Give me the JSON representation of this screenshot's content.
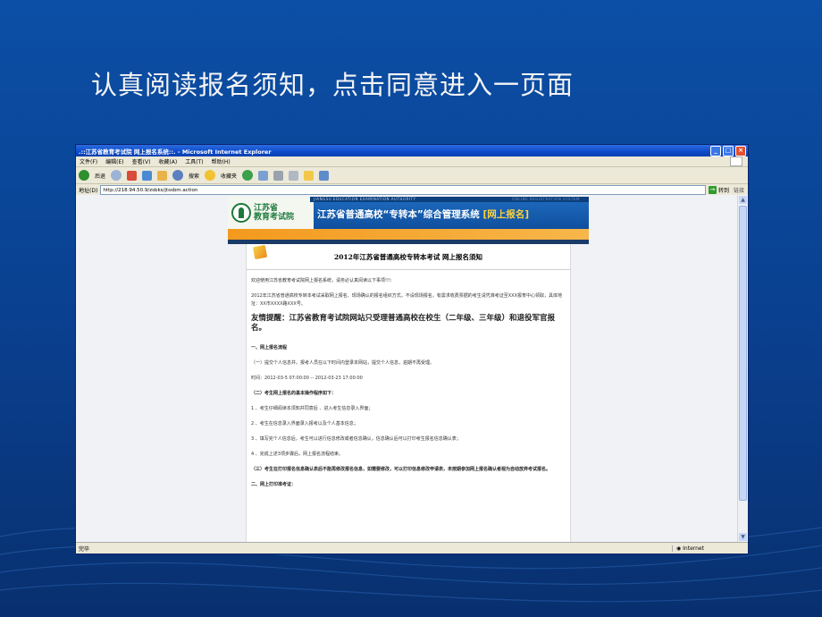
{
  "slide": {
    "title": "认真阅读报名须知，点击同意进入一页面"
  },
  "browser": {
    "window_title": ".::江苏省教育考试院 网上报名系统::. - Microsoft Internet Explorer",
    "menu": [
      "文件(F)",
      "编辑(E)",
      "查看(V)",
      "收藏(A)",
      "工具(T)",
      "帮助(H)"
    ],
    "toolbar": {
      "back": "后退",
      "search": "搜索",
      "favorites": "收藏夹"
    },
    "address_label": "地址(D)",
    "address": "http://218.94.50.9/zsbks/jtssbm.action",
    "go_label": "转到",
    "links_label": "链接",
    "status_left": "完毕",
    "status_zone": "Internet"
  },
  "site": {
    "logo_line1": "江苏省",
    "logo_line2": "教育考试院",
    "strip_left": "JIANGSU EDUCATION EXAMINATION AUTHORITY",
    "strip_right": "ONLINE REGISTRATION SYSTEM",
    "banner_title": "江苏省普通高校“专转本”综合管理系统",
    "banner_title_hl": "[网上报名]"
  },
  "notice": {
    "title": "2012年江苏省普通高校专转本考试 网上报名须知",
    "p1": "欢迎使用江苏省教育考试院网上报名系统，请务必认真阅读以下事项!!!:",
    "p2": "2012年江苏省普通高校专转本考试采取网上报名、现场确认的报名组织方式，不设现场报名。有需求收费票据的考生请凭准考证至XXX报育中心领取，具体地址：XX市XXXX路XXX号。",
    "reminder": "友情提醒：江苏省教育考试院网站只受理普通高校在校生（二年级、三年级）和退役军官报名。",
    "s1": "一、网上报名流程",
    "s1_1": "（一）提交个人信息并。报考人员在以下时间内登录本网站，提交个人信息，逾期不再受理。",
    "time": "时间：2012-03-5 07:00:00 -- 2012-03-23 17:00:00",
    "s2": "（二）考生网上报名的基本操作程序如下：",
    "step1": "1 、考生仔细阅读本须知并同意后 、进入考生信息录入界面；",
    "step2": "2 、考生在信息录入界面录入报考以及个人基本信息；",
    "step3": "3 、填写完个人信息后，考生可以进行信息修改或者信息确认，信息确认后可以打印考生报名信息确认表；",
    "step4": "4 、完成上述3项步骤后，网上报名流程结束。",
    "s3": "（三）考生在打印报名信息确认表后不能再修改报名信息，如需要修改，可以打印信息修改申请表，未按期参加网上报名确认者视为自动放弃考试报名。",
    "s4": "二、网上打印准考证："
  },
  "colors": {
    "slide_bg": "#0b4fa6",
    "banner_blue": "#1f6cc0",
    "accent_orange": "#f39a1e",
    "logo_green": "#1b7a3a"
  }
}
